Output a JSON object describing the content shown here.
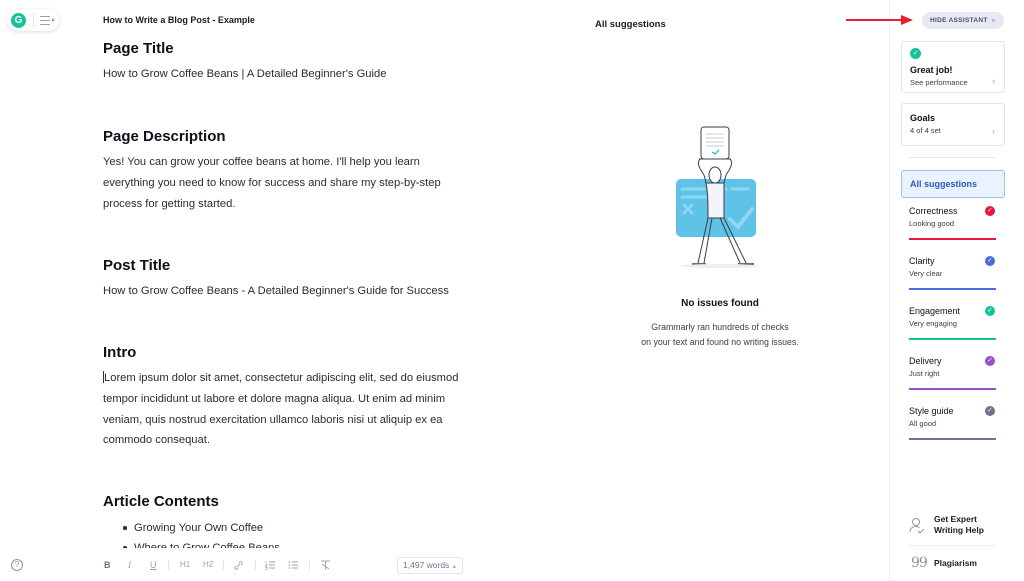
{
  "app": {
    "logo_letter": "G",
    "doc_title": "How to Write a Blog Post - Example"
  },
  "document": {
    "sections": [
      {
        "heading": "Page Title",
        "body": "How to Grow Coffee Beans | A Detailed Beginner's Guide"
      },
      {
        "heading": "Page Description",
        "body": "Yes! You can grow your coffee beans at home. I'll help you learn everything you need to know for success and share my step-by-step process for getting started."
      },
      {
        "heading": "Post Title",
        "body": "How to Grow Coffee Beans - A Detailed Beginner's Guide for Success"
      },
      {
        "heading": "Intro",
        "body": "Lorem ipsum dolor sit amet, consectetur adipiscing elit, sed do eiusmod tempor incididunt ut labore et dolore magna aliqua. Ut enim ad minim veniam, quis nostrud exercitation ullamco laboris nisi ut aliquip ex ea commodo consequat."
      },
      {
        "heading": "Article Contents",
        "list": [
          "Growing Your Own Coffee",
          "Where to Grow Coffee Beans"
        ]
      }
    ]
  },
  "toolbar": {
    "help": "?",
    "bold": "B",
    "italic": "I",
    "underline": "U",
    "h1": "H1",
    "h2": "H2",
    "word_count": "1,497 words",
    "word_count_caret": "▲"
  },
  "suggestions_panel": {
    "title": "All suggestions",
    "empty_title": "No issues found",
    "empty_desc_line1": "Grammarly ran hundreds of checks",
    "empty_desc_line2": "on your text and found no writing issues."
  },
  "sidebar": {
    "hide_button": "HIDE ASSISTANT",
    "hide_chevron": "»",
    "performance": {
      "title": "Great job!",
      "subtitle": "See performance"
    },
    "goals": {
      "title": "Goals",
      "subtitle": "4 of 4 set"
    },
    "all_suggestions": "All suggestions",
    "categories": [
      {
        "name": "Correctness",
        "status": "Looking good",
        "color": "#e5173f"
      },
      {
        "name": "Clarity",
        "status": "Very clear",
        "color": "#4a6ee0"
      },
      {
        "name": "Engagement",
        "status": "Very engaging",
        "color": "#15c39a"
      },
      {
        "name": "Delivery",
        "status": "Just right",
        "color": "#9b4dca"
      },
      {
        "name": "Style guide",
        "status": "All good",
        "color": "#6d758d"
      }
    ],
    "expert_help_line1": "Get Expert",
    "expert_help_line2": "Writing Help",
    "plagiarism": "Plagiarism"
  },
  "annotation": {
    "arrow_color": "#e8202e"
  }
}
